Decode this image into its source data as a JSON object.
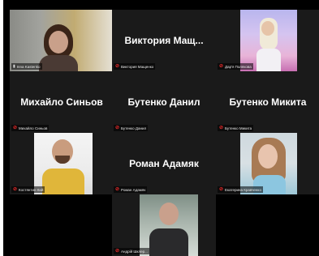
{
  "participants": [
    {
      "display_name": "",
      "label": "Inna Kastenko",
      "muted": false,
      "video": true
    },
    {
      "display_name": "Виктория  Мащ...",
      "label": "Виктория Мащенко",
      "muted": true,
      "video": false
    },
    {
      "display_name": "",
      "label": "Дар'я Полякова",
      "muted": true,
      "video": true
    },
    {
      "display_name": "Михайло Синьов",
      "label": "Михайло Синьов",
      "muted": true,
      "video": false
    },
    {
      "display_name": "Бутенко Данил",
      "label": "Бутенко Данил",
      "muted": true,
      "video": false
    },
    {
      "display_name": "Бутенко Микита",
      "label": "Бутенко Микита",
      "muted": true,
      "video": false
    },
    {
      "display_name": "",
      "label": "Костянтин Кий",
      "muted": true,
      "video": true
    },
    {
      "display_name": "Роман Адамяк",
      "label": "Роман Адамяк",
      "muted": true,
      "video": false
    },
    {
      "display_name": "",
      "label": "Екатерина Кравченко",
      "muted": true,
      "video": true
    },
    {
      "display_name": "",
      "label": "Андрій Шклер...",
      "muted": true,
      "video": true
    }
  ],
  "icons": {
    "muted": "mic-muted-icon",
    "unmuted": "mic-icon"
  },
  "colors": {
    "active_border": "#cfe04a",
    "muted": "#e02828",
    "tile_bg": "#1a1a1a"
  }
}
